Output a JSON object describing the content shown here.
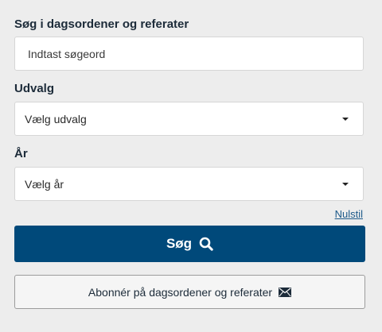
{
  "search": {
    "label": "Søg i dagsordener og referater",
    "placeholder": "Indtast søgeord"
  },
  "committee": {
    "label": "Udvalg",
    "selected": "Vælg udvalg"
  },
  "year": {
    "label": "År",
    "selected": "Vælg år"
  },
  "reset_label": "Nulstil",
  "search_button": {
    "label": "Søg",
    "icon": "search-icon"
  },
  "subscribe_button": {
    "label": "Abonnér på dagsordener og referater",
    "icon": "envelope-icon"
  },
  "colors": {
    "background": "#ededed",
    "primary": "#00497a",
    "link": "#1d5a8a",
    "text": "#1c2b39"
  }
}
